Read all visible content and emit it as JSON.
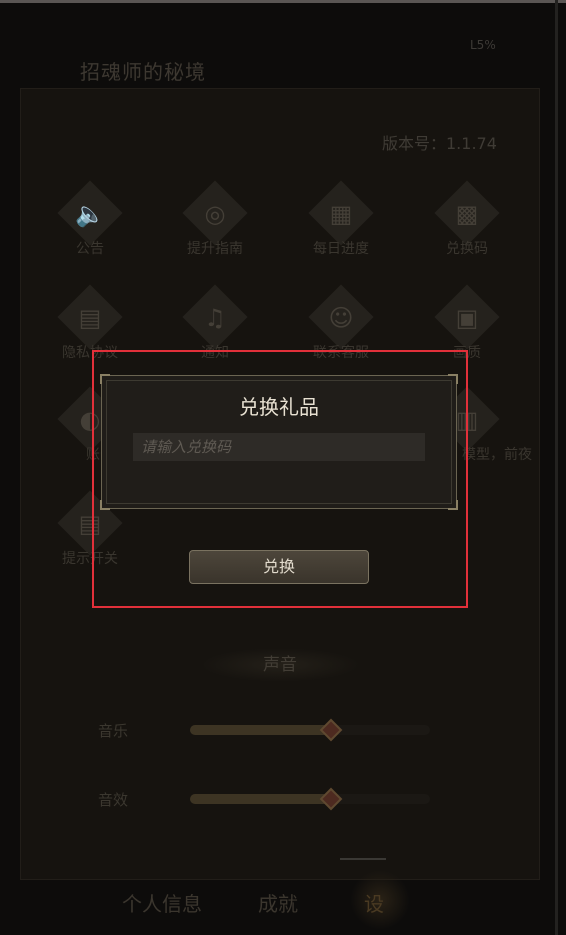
{
  "header": {
    "title": "招魂师的秘境",
    "status_right": "L5%"
  },
  "settings": {
    "version_text": "版本号：1.1.74",
    "grid": [
      {
        "icon": "speaker-icon",
        "glyph": "🔈",
        "label": "公告"
      },
      {
        "icon": "guide-icon",
        "glyph": "◎",
        "label": "提升指南"
      },
      {
        "icon": "calendar-icon",
        "glyph": "▦",
        "label": "每日进度"
      },
      {
        "icon": "qr-code-icon",
        "glyph": "▩",
        "label": "兑换码"
      },
      {
        "icon": "document-icon",
        "glyph": "▤",
        "label": "隐私协议"
      },
      {
        "icon": "bell-icon",
        "glyph": "♫",
        "label": "通知"
      },
      {
        "icon": "headset-icon",
        "glyph": "☺",
        "label": "联系客服"
      },
      {
        "icon": "image-icon",
        "glyph": "▣",
        "label": "画质"
      },
      {
        "icon": "account-icon",
        "glyph": "◐",
        "label": "账号"
      },
      {
        "icon": "moon-icon",
        "glyph": "▥",
        "label": "模型，前夜"
      },
      {
        "icon": "tip-icon",
        "glyph": "▤",
        "label": "提示开关"
      }
    ],
    "sound_section": "声音",
    "music_label": "音乐",
    "music_level": 0.58,
    "sfx_label": "音效",
    "sfx_level": 0.58
  },
  "tabs": {
    "profile": "个人信息",
    "achievements": "成就",
    "settings": "设"
  },
  "modal": {
    "title": "兑换礼品",
    "input_placeholder": "请输入兑换码",
    "input_value": "",
    "redeem_button": "兑换"
  },
  "colors": {
    "highlight": "#e2303a",
    "accent": "#6b6552"
  }
}
